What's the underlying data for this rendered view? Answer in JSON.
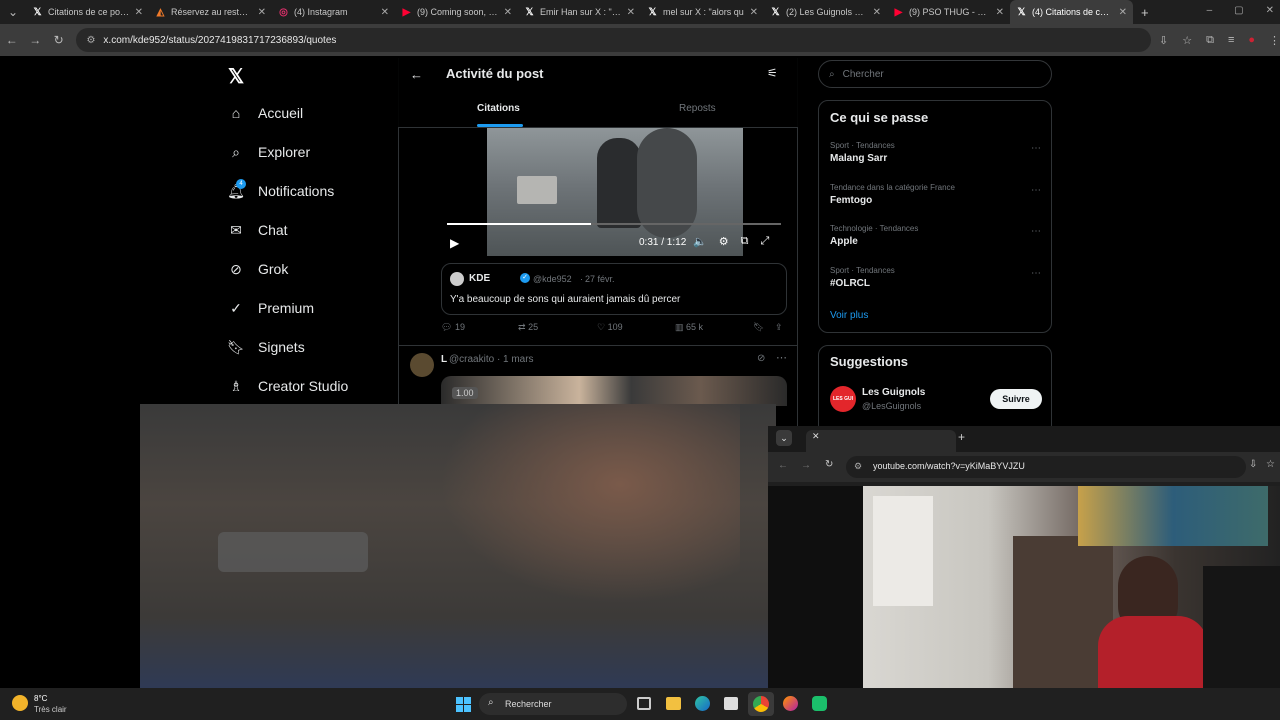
{
  "browser": {
    "tabs": [
      {
        "icon": "x-logo-icon",
        "title": "Citations de ce post /"
      },
      {
        "icon": "restaurant-icon",
        "title": "Réservez au restaura"
      },
      {
        "icon": "instagram-icon",
        "title": "(4) Instagram"
      },
      {
        "icon": "youtube-icon",
        "title": "(9) Coming soon, a n"
      },
      {
        "icon": "x-logo-icon",
        "title": "Emir Han sur X : \"Eve"
      },
      {
        "icon": "x-logo-icon",
        "title": "mel sur X : \"alors qu"
      },
      {
        "icon": "x-logo-icon",
        "title": "(2) Les Guignols sur X"
      },
      {
        "icon": "youtube-icon",
        "title": "(9) PSO THUG - Plein"
      },
      {
        "icon": "x-logo-icon",
        "title": "(4) Citations de ce po"
      }
    ],
    "url": "x.com/kde952/status/2027419831717236893/quotes"
  },
  "sidebar": {
    "items": [
      {
        "icon": "home-icon",
        "label": "Accueil"
      },
      {
        "icon": "search-icon",
        "label": "Explorer"
      },
      {
        "icon": "bell-icon",
        "label": "Notifications",
        "badge": "4"
      },
      {
        "icon": "mail-icon",
        "label": "Chat"
      },
      {
        "icon": "grok-icon",
        "label": "Grok"
      },
      {
        "icon": "verified-icon",
        "label": "Premium"
      },
      {
        "icon": "bookmark-icon",
        "label": "Signets"
      },
      {
        "icon": "creator-icon",
        "label": "Creator Studio"
      }
    ]
  },
  "header": {
    "title": "Activité du post",
    "tabs": [
      "Citations",
      "Reposts"
    ]
  },
  "video": {
    "time": "0:31 / 1:12"
  },
  "quoted": {
    "name": "KDE",
    "handle": "@kde952",
    "date": "27 févr.",
    "text": "Y'a beaucoup de sons qui auraient jamais dû percer"
  },
  "actions": {
    "replies": "19",
    "reposts": "25",
    "likes": "109",
    "views": "65 k"
  },
  "next_post": {
    "name": "L",
    "handle": "@craakito",
    "date": "1 mars",
    "badge": "1.00"
  },
  "right": {
    "search_placeholder": "Chercher",
    "trends_title": "Ce qui se passe",
    "trends": [
      {
        "context": "Sport · Tendances",
        "name": "Malang Sarr"
      },
      {
        "context": "Tendance dans la catégorie France",
        "name": "Femtogo"
      },
      {
        "context": "Technologie · Tendances",
        "name": "Apple"
      },
      {
        "context": "Sport · Tendances",
        "name": "#OLRCL"
      }
    ],
    "show_more": "Voir plus",
    "suggestions_title": "Suggestions",
    "suggestion": {
      "name": "Les Guignols",
      "handle": "@LesGuignols",
      "follow": "Suivre"
    }
  },
  "pip": {
    "url": "youtube.com/watch?v=yKiMaBYVJZU"
  },
  "taskbar": {
    "temp": "8°C",
    "weather": "Très clair",
    "search": "Rechercher"
  }
}
